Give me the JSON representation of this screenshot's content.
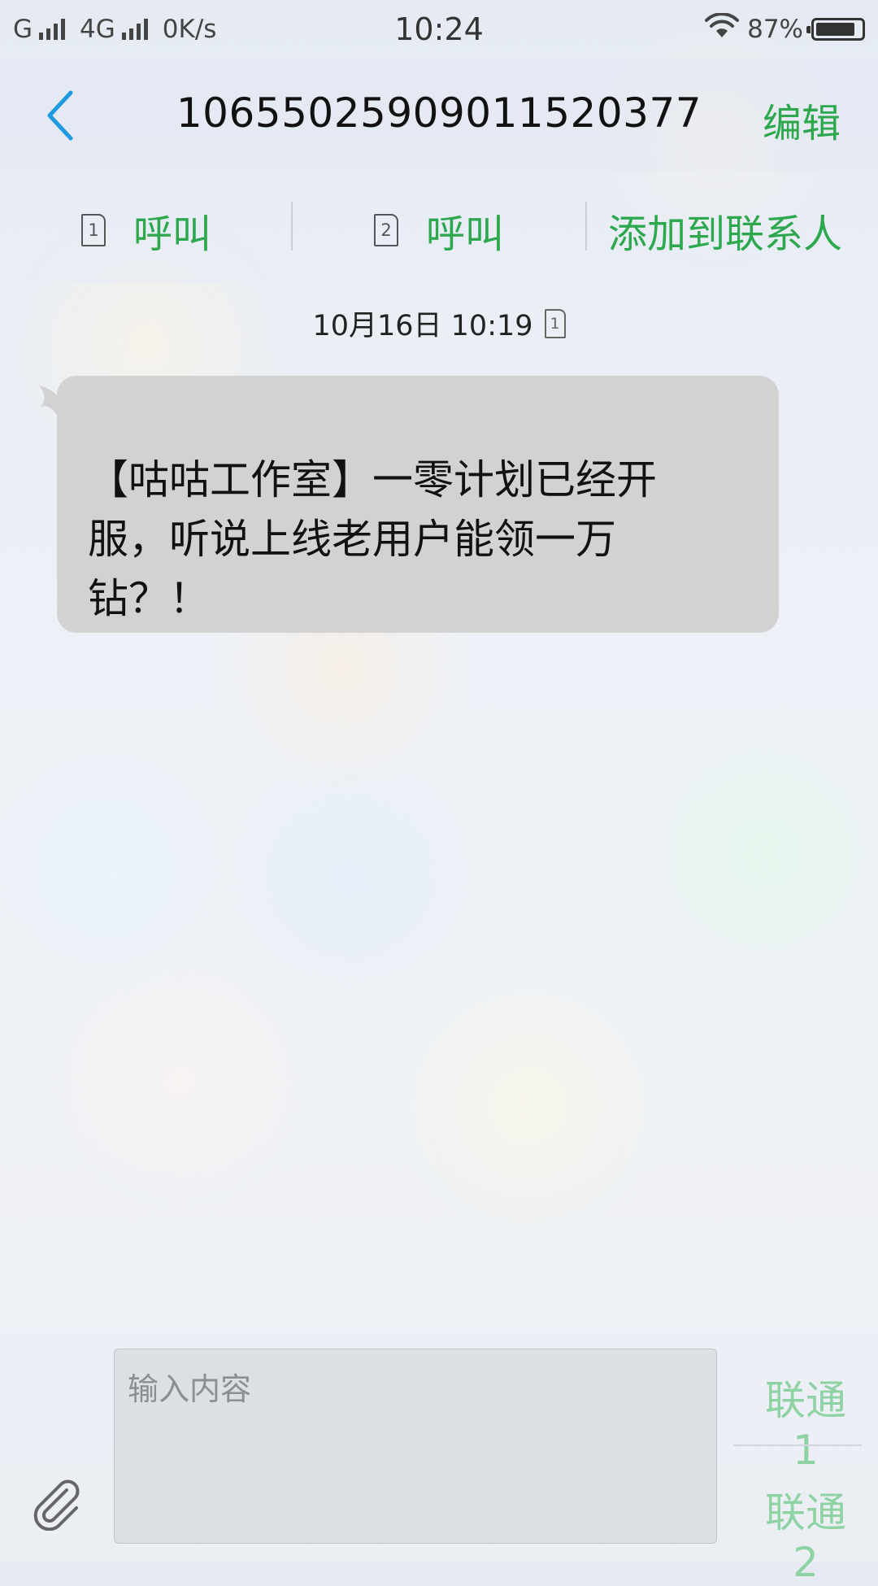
{
  "status_bar": {
    "carrier1": "G",
    "carrier2": "4G",
    "speed": "0K/s",
    "time": "10:24",
    "battery_text": "87%",
    "battery_level": 0.87
  },
  "header": {
    "title": "10655025909011520377",
    "edit_label": "编辑",
    "back_icon": "chevron-left-icon"
  },
  "actions": {
    "call1_sim": "1",
    "call1_label": "呼叫",
    "call2_sim": "2",
    "call2_label": "呼叫",
    "add_contact_label": "添加到联系人"
  },
  "conversation": {
    "timestamp": "10月16日 10:19",
    "timestamp_sim": "1",
    "messages": [
      {
        "text": "【咕咕工作室】一零计划已经开服，听说上线老用户能领一万钻？！"
      }
    ]
  },
  "compose": {
    "placeholder": "输入内容",
    "send1_label": "联通1",
    "send2_label": "联通2",
    "attach_icon": "paperclip-icon"
  },
  "colors": {
    "accent_green": "#2da84f",
    "accent_blue": "#1e9be0",
    "bubble": "#d2d2d3"
  }
}
